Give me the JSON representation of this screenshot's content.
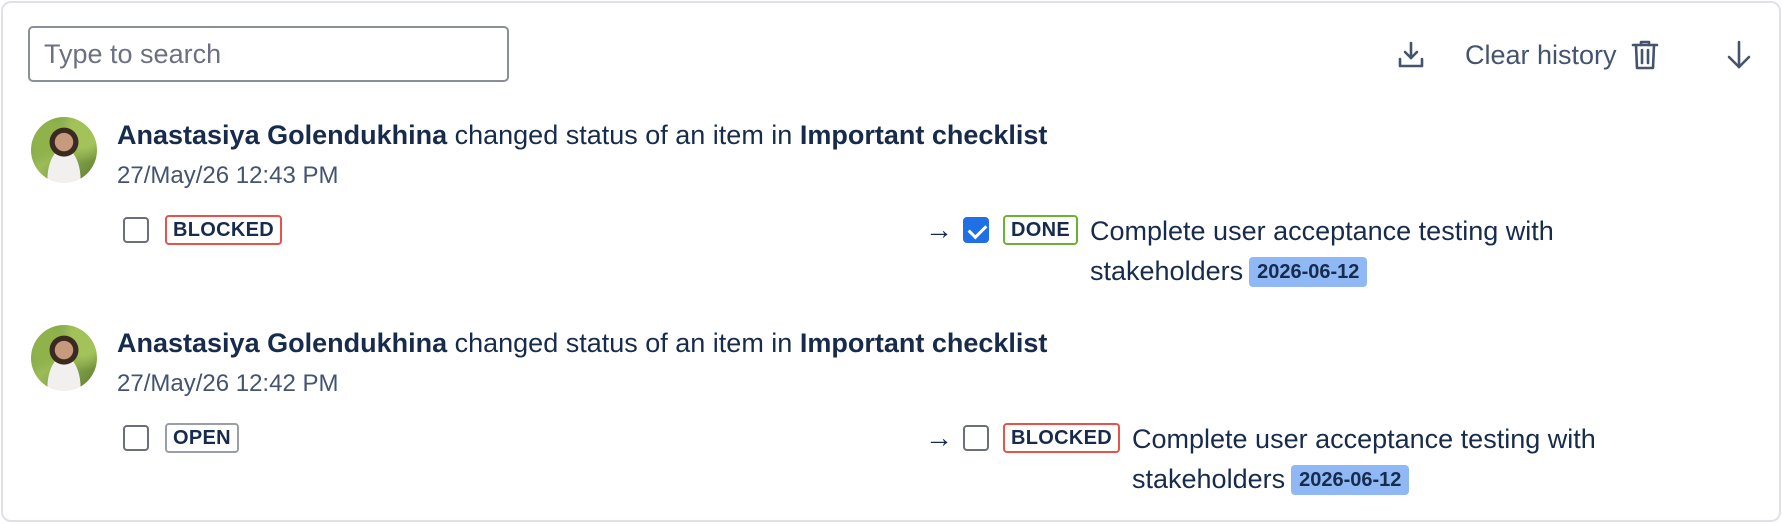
{
  "toolbar": {
    "search_placeholder": "Type to search",
    "clear_history_label": "Clear history",
    "icons": [
      "download-icon",
      "trash-icon",
      "arrow-down-icon"
    ]
  },
  "entries": [
    {
      "user": "Anastasiya Golendukhina",
      "action": "changed status of an item in",
      "checklist": "Important checklist",
      "timestamp": "27/May/26 12:43 PM",
      "from": {
        "checked": false,
        "status": "BLOCKED"
      },
      "arrow": "→",
      "to": {
        "checked": true,
        "status": "DONE"
      },
      "item_line1": "Complete user acceptance testing with",
      "item_line2": "stakeholders",
      "due_date": "2026-06-12"
    },
    {
      "user": "Anastasiya Golendukhina",
      "action": "changed status of an item in",
      "checklist": "Important checklist",
      "timestamp": "27/May/26 12:42 PM",
      "from": {
        "checked": false,
        "status": "OPEN"
      },
      "arrow": "→",
      "to": {
        "checked": false,
        "status": "BLOCKED"
      },
      "item_line1": "Complete user acceptance testing with",
      "item_line2": "stakeholders",
      "due_date": "2026-06-12"
    }
  ],
  "colors": {
    "status_blocked": "#e5534b",
    "status_done": "#6bb233",
    "status_open": "#9a9ea8",
    "date_badge": "#8fb8f5",
    "checkbox_checked": "#1f6fe5"
  }
}
